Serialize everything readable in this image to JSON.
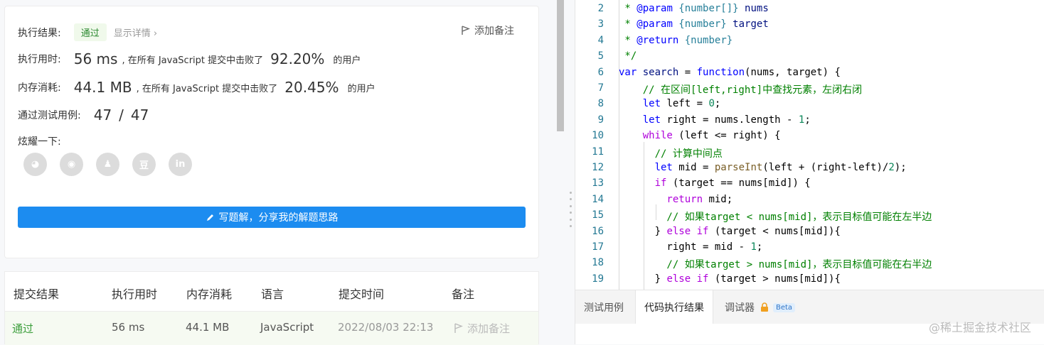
{
  "result_card": {
    "result_label": "执行结果:",
    "result_status": "通过",
    "show_details": "显示详情 ›",
    "add_note": "添加备注",
    "runtime_label": "执行用时:",
    "runtime_value": "56 ms",
    "runtime_mid": ", 在所有 JavaScript 提交中击败了",
    "runtime_percent": "92.20%",
    "runtime_tail": "的用户",
    "memory_label": "内存消耗:",
    "memory_value": "44.1 MB",
    "memory_mid": ", 在所有 JavaScript 提交中击败了",
    "memory_percent": "20.45%",
    "memory_tail": "的用户",
    "tests_label": "通过测试用例:",
    "tests_passed": "47",
    "tests_sep": "/",
    "tests_total": "47",
    "share_label": "炫耀一下:",
    "share_icons": [
      {
        "name": "wechat-icon",
        "glyph": "◕"
      },
      {
        "name": "weibo-icon",
        "glyph": "◉"
      },
      {
        "name": "qq-icon",
        "glyph": "♟"
      },
      {
        "name": "douban-icon",
        "glyph": "豆"
      },
      {
        "name": "linkedin-icon",
        "glyph": "in"
      }
    ],
    "write_solution": "写题解，分享我的解题思路"
  },
  "submissions": {
    "headers": [
      "提交结果",
      "执行用时",
      "内存消耗",
      "语言",
      "提交时间",
      "备注"
    ],
    "row": {
      "status": "通过",
      "runtime": "56 ms",
      "memory": "44.1 MB",
      "language": "JavaScript",
      "time": "2022/08/03 22:13",
      "note": "添加备注"
    }
  },
  "code_lines": [
    {
      "n": "2",
      "tokens": [
        {
          "t": " * ",
          "c": "#008000"
        },
        {
          "t": "@param",
          "c": "#0000ff"
        },
        {
          "t": " {number[]} ",
          "c": "#267f99"
        },
        {
          "t": "nums",
          "c": "#001080"
        }
      ]
    },
    {
      "n": "3",
      "tokens": [
        {
          "t": " * ",
          "c": "#008000"
        },
        {
          "t": "@param",
          "c": "#0000ff"
        },
        {
          "t": " {number} ",
          "c": "#267f99"
        },
        {
          "t": "target",
          "c": "#001080"
        }
      ]
    },
    {
      "n": "4",
      "tokens": [
        {
          "t": " * ",
          "c": "#008000"
        },
        {
          "t": "@return",
          "c": "#0000ff"
        },
        {
          "t": " {number}",
          "c": "#267f99"
        }
      ]
    },
    {
      "n": "5",
      "tokens": [
        {
          "t": " */",
          "c": "#008000"
        }
      ]
    },
    {
      "n": "6",
      "tokens": [
        {
          "t": "var ",
          "c": "#0000ff"
        },
        {
          "t": "search",
          "c": "#001080"
        },
        {
          "t": " = ",
          "c": "#000000"
        },
        {
          "t": "function",
          "c": "#0000ff"
        },
        {
          "t": "(nums, target) {",
          "c": "#000000"
        }
      ]
    },
    {
      "n": "7",
      "tokens": [
        {
          "t": "    // 在区间[left,right]中查找元素，左闭右闭",
          "c": "#008000"
        }
      ]
    },
    {
      "n": "8",
      "tokens": [
        {
          "t": "    let ",
          "c": "#0000ff"
        },
        {
          "t": "left = ",
          "c": "#000000"
        },
        {
          "t": "0",
          "c": "#098658"
        },
        {
          "t": ";",
          "c": "#000000"
        }
      ]
    },
    {
      "n": "9",
      "tokens": [
        {
          "t": "    let ",
          "c": "#0000ff"
        },
        {
          "t": "right = nums.length - ",
          "c": "#000000"
        },
        {
          "t": "1",
          "c": "#098658"
        },
        {
          "t": ";",
          "c": "#000000"
        }
      ]
    },
    {
      "n": "10",
      "tokens": [
        {
          "t": "    while",
          "c": "#af00db"
        },
        {
          "t": " (left <= right) {",
          "c": "#000000"
        }
      ]
    },
    {
      "n": "11",
      "tokens": [
        {
          "t": "      // 计算中间点",
          "c": "#008000"
        }
      ]
    },
    {
      "n": "12",
      "tokens": [
        {
          "t": "      let ",
          "c": "#0000ff"
        },
        {
          "t": "mid = ",
          "c": "#000000"
        },
        {
          "t": "parseInt",
          "c": "#795e26"
        },
        {
          "t": "(left + (right-left)/",
          "c": "#000000"
        },
        {
          "t": "2",
          "c": "#098658"
        },
        {
          "t": ");",
          "c": "#000000"
        }
      ]
    },
    {
      "n": "13",
      "tokens": [
        {
          "t": "      if",
          "c": "#af00db"
        },
        {
          "t": " (target == nums[mid]) {",
          "c": "#000000"
        }
      ]
    },
    {
      "n": "14",
      "tokens": [
        {
          "t": "        return",
          "c": "#af00db"
        },
        {
          "t": " mid;",
          "c": "#000000"
        }
      ]
    },
    {
      "n": "15",
      "tokens": [
        {
          "t": "        // 如果target < nums[mid]，表示目标值可能在左半边",
          "c": "#008000"
        }
      ]
    },
    {
      "n": "16",
      "tokens": [
        {
          "t": "      } ",
          "c": "#000000"
        },
        {
          "t": "else if",
          "c": "#af00db"
        },
        {
          "t": " (target < nums[mid]){",
          "c": "#000000"
        }
      ]
    },
    {
      "n": "17",
      "tokens": [
        {
          "t": "        right = mid - ",
          "c": "#000000"
        },
        {
          "t": "1",
          "c": "#098658"
        },
        {
          "t": ";",
          "c": "#000000"
        }
      ]
    },
    {
      "n": "18",
      "tokens": [
        {
          "t": "        // 如果target > nums[mid]，表示目标值可能在右半边",
          "c": "#008000"
        }
      ]
    },
    {
      "n": "19",
      "tokens": [
        {
          "t": "      } ",
          "c": "#000000"
        },
        {
          "t": "else if",
          "c": "#af00db"
        },
        {
          "t": " (target > nums[mid]){",
          "c": "#000000"
        }
      ]
    }
  ],
  "bottom_tabs": {
    "testcases": "测试用例",
    "run_result": "代码执行结果",
    "debugger": "调试器",
    "beta": "Beta"
  },
  "watermark": "@稀土掘金技术社区",
  "colors": {
    "pass_green": "#2d8a32",
    "primary_blue": "#1c8cf0",
    "row_highlight": "#f6faf2"
  }
}
